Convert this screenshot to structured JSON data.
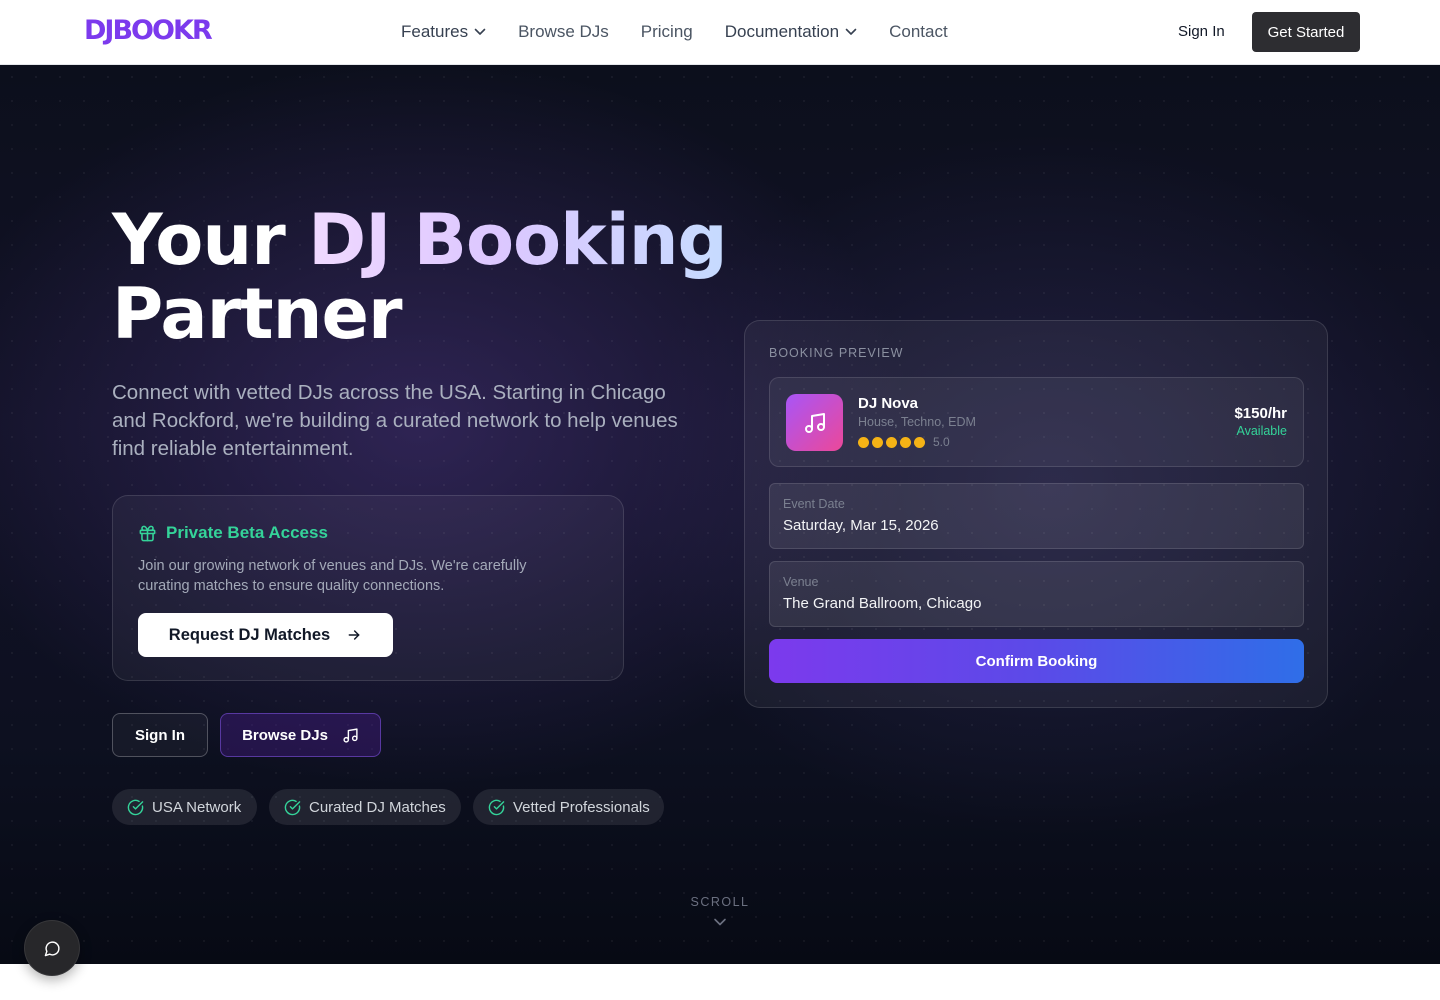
{
  "brand": {
    "logo_text": "DJBOOKR",
    "accent": "#7c3aed"
  },
  "nav": {
    "links": [
      {
        "label": "Features",
        "dropdown": true
      },
      {
        "label": "Browse DJs",
        "dropdown": false
      },
      {
        "label": "Pricing",
        "dropdown": false
      },
      {
        "label": "Documentation",
        "dropdown": true
      },
      {
        "label": "Contact",
        "dropdown": false
      }
    ],
    "sign_in": "Sign In",
    "cta": "Get Started"
  },
  "hero": {
    "title_line1_plain": "Your",
    "title_line1_gradient": "DJ Booking",
    "title_line2": "Partner",
    "subtitle": "Connect with vetted DJs across the USA. Starting in Chicago and Rockford, we're building a curated network to help venues find reliable entertainment.",
    "beta": {
      "title": "Private Beta Access",
      "text": "Join our growing network of venues and DJs. We're carefully curating matches to ensure quality connections.",
      "button": "Request DJ Matches",
      "icon": "gift-icon"
    },
    "secondary_buttons": {
      "sign_in": "Sign In",
      "browse": "Browse DJs"
    },
    "chips": [
      "USA Network",
      "Curated DJ Matches",
      "Vetted Professionals"
    ],
    "scroll_label": "SCROLL"
  },
  "booking_preview": {
    "label": "BOOKING PREVIEW",
    "dj": {
      "name": "DJ Nova",
      "genres": "House, Techno, EDM",
      "rating": "5.0",
      "stars": 5,
      "price": "$150/hr",
      "status": "Available"
    },
    "fields": [
      {
        "label": "Event Date",
        "value": "Saturday, Mar 15, 2026"
      },
      {
        "label": "Venue",
        "value": "The Grand Ballroom, Chicago"
      }
    ],
    "confirm": "Confirm Booking"
  },
  "colors": {
    "success": "#34d399",
    "star": "#f5b316",
    "nav_cta_bg": "#2d2d31"
  }
}
